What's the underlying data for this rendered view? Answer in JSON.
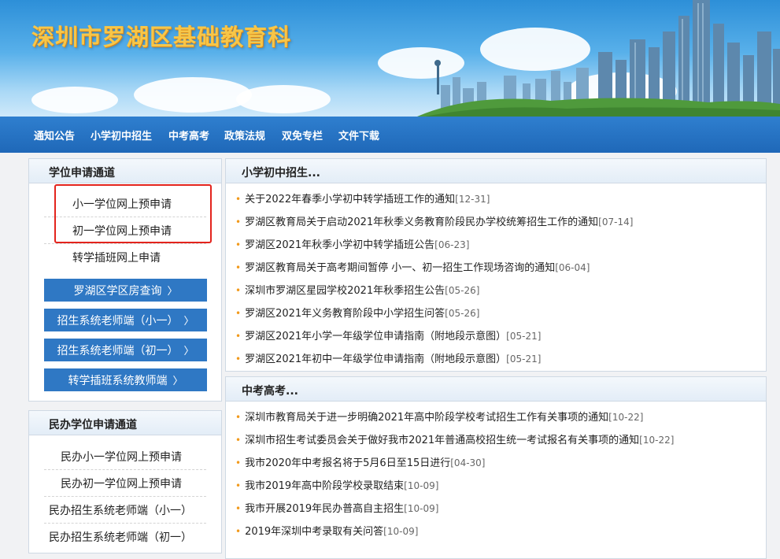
{
  "header": {
    "site_title": "深圳市罗湖区基础教育科"
  },
  "nav": {
    "items": [
      "通知公告",
      "小学初中招生",
      "中考高考",
      "政策法规",
      "双免专栏",
      "文件下载"
    ]
  },
  "xuewei": {
    "title": "学位申请通道",
    "links": [
      "小一学位网上预申请",
      "初一学位网上预申请",
      "转学插班网上申请"
    ],
    "buttons": [
      "罗湖区学区房查询",
      "招生系统老师端（小一）",
      "招生系统老师端（初一）",
      "转学插班系统教师端"
    ],
    "chevron": "〉"
  },
  "minban": {
    "title": "民办学位申请通道",
    "links": [
      "民办小一学位网上预申请",
      "民办初一学位网上预申请",
      "民办招生系统老师端（小一）",
      "民办招生系统老师端（初一）"
    ]
  },
  "xiaoxue": {
    "title": "小学初中招生...",
    "bullet": "•",
    "items": [
      {
        "text": "关于2022年春季小学初中转学插班工作的通知",
        "date": "[12-31]"
      },
      {
        "text": "罗湖区教育局关于启动2021年秋季义务教育阶段民办学校统筹招生工作的通知",
        "date": "[07-14]"
      },
      {
        "text": "罗湖区2021年秋季小学初中转学插班公告",
        "date": "[06-23]"
      },
      {
        "text": "罗湖区教育局关于高考期间暂停 小一、初一招生工作现场咨询的通知",
        "date": "[06-04]"
      },
      {
        "text": "深圳市罗湖区星园学校2021年秋季招生公告",
        "date": "[05-26]"
      },
      {
        "text": "罗湖区2021年义务教育阶段中小学招生问答",
        "date": "[05-26]"
      },
      {
        "text": "罗湖区2021年小学一年级学位申请指南（附地段示意图）",
        "date": "[05-21]"
      },
      {
        "text": "罗湖区2021年初中一年级学位申请指南（附地段示意图）",
        "date": "[05-21]"
      }
    ]
  },
  "zhongkao": {
    "title": "中考高考...",
    "bullet": "•",
    "items": [
      {
        "text": "深圳市教育局关于进一步明确2021年高中阶段学校考试招生工作有关事项的通知",
        "date": "[10-22]"
      },
      {
        "text": "深圳市招生考试委员会关于做好我市2021年普通高校招生统一考试报名有关事项的通知",
        "date": "[10-22]"
      },
      {
        "text": "我市2020年中考报名将于5月6日至15日进行",
        "date": "[04-30]"
      },
      {
        "text": "我市2019年高中阶段学校录取结束",
        "date": "[10-09]"
      },
      {
        "text": "我市开展2019年民办普高自主招生",
        "date": "[10-09]"
      },
      {
        "text": "2019年深圳中考录取有关问答",
        "date": "[10-09]"
      }
    ]
  }
}
